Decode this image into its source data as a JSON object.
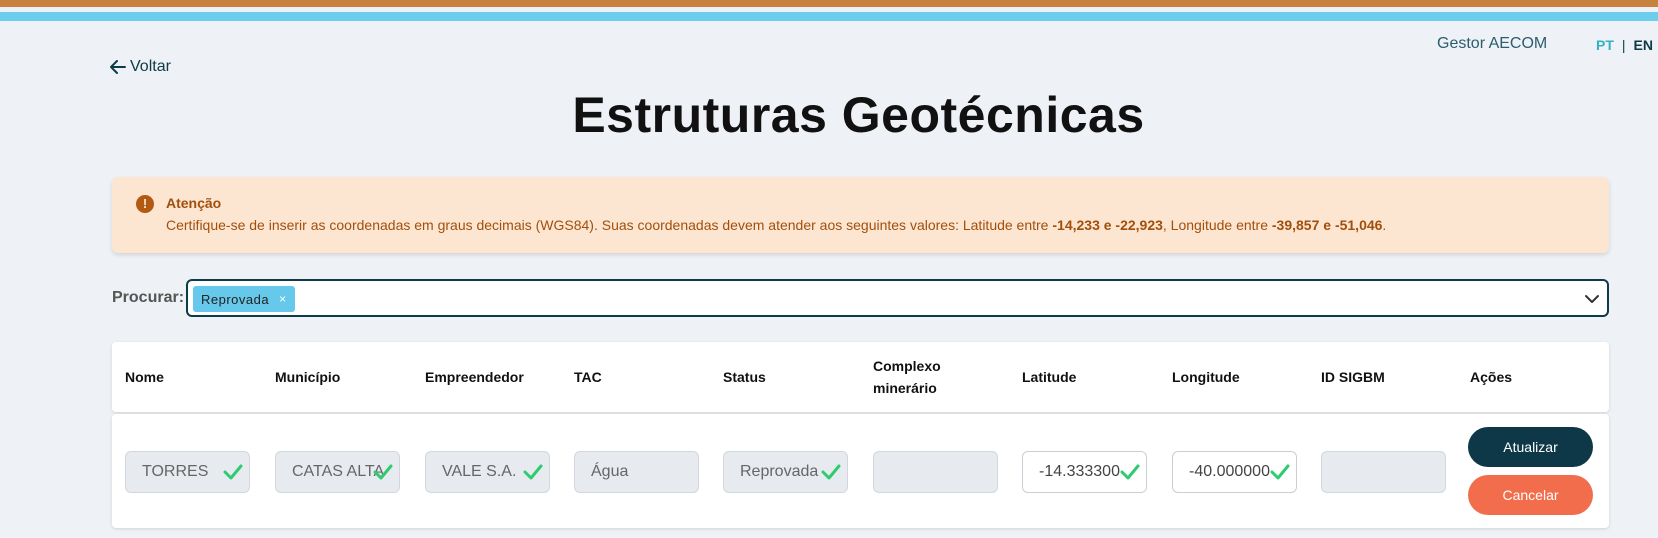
{
  "header": {
    "manager": "Gestor AECOM",
    "lang_pt": "PT",
    "lang_sep": "|",
    "lang_en": "EN",
    "back_label": "Voltar",
    "title": "Estruturas Geotécnicas"
  },
  "alert": {
    "icon": "!",
    "title": "Atenção",
    "text_1": "Certifique-se de inserir as coordenadas em graus decimais (WGS84). Suas coordenadas devem atender aos seguintes valores: Latitude entre ",
    "lat_range": "-14,233 e -22,923",
    "text_2": ", Longitude entre ",
    "lon_range": "-39,857 e -51,046",
    "text_3": "."
  },
  "search": {
    "label": "Procurar:",
    "chip_label": "Reprovada",
    "chip_remove": "×"
  },
  "table": {
    "headers": [
      "Nome",
      "Município",
      "Empreendedor",
      "TAC",
      "Status",
      "Complexo minerário",
      "Latitude",
      "Longitude",
      "ID SIGBM",
      "Ações"
    ],
    "row": {
      "nome": "TORRES",
      "municipio": "CATAS ALTA",
      "empreendedor": "VALE S.A.",
      "tac": "Água",
      "status": "Reprovada",
      "complexo": "",
      "latitude": "-14.333300",
      "longitude": "-40.000000",
      "id_sigbm": ""
    },
    "actions": {
      "update_label": "Atualizar",
      "cancel_label": "Cancelar"
    }
  },
  "colors": {
    "accent_dark": "#0e3848",
    "cancel": "#f26d4c",
    "check": "#2ecc71",
    "alert_bg": "#fde6d1",
    "alert_text": "#a24f0c"
  }
}
